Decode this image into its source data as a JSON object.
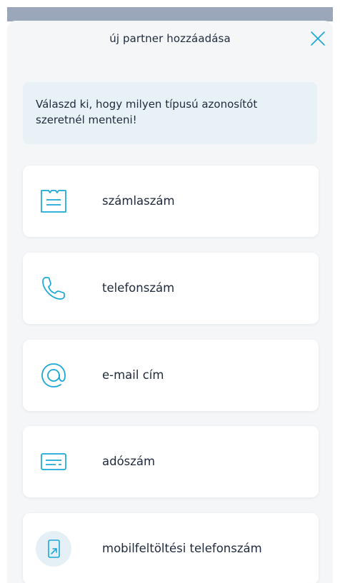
{
  "header": {
    "title": "új partner hozzáadása",
    "close_icon": "close-icon"
  },
  "info": {
    "text": "Válaszd ki, hogy milyen típusú azonosítót szeretnél menteni!"
  },
  "options": [
    {
      "label": "számlaszám",
      "icon": "invoice-icon"
    },
    {
      "label": "telefonszám",
      "icon": "phone-icon"
    },
    {
      "label": "e-mail cím",
      "icon": "at-sign-icon"
    },
    {
      "label": "adószám",
      "icon": "id-card-icon"
    },
    {
      "label": "mobilfeltöltési telefonszám",
      "icon": "mobile-topup-icon"
    }
  ],
  "colors": {
    "accent": "#1ba7d6",
    "text": "#1f2a3c",
    "info_background": "#e8f2f6",
    "sheet_background": "#f4f6f8"
  }
}
